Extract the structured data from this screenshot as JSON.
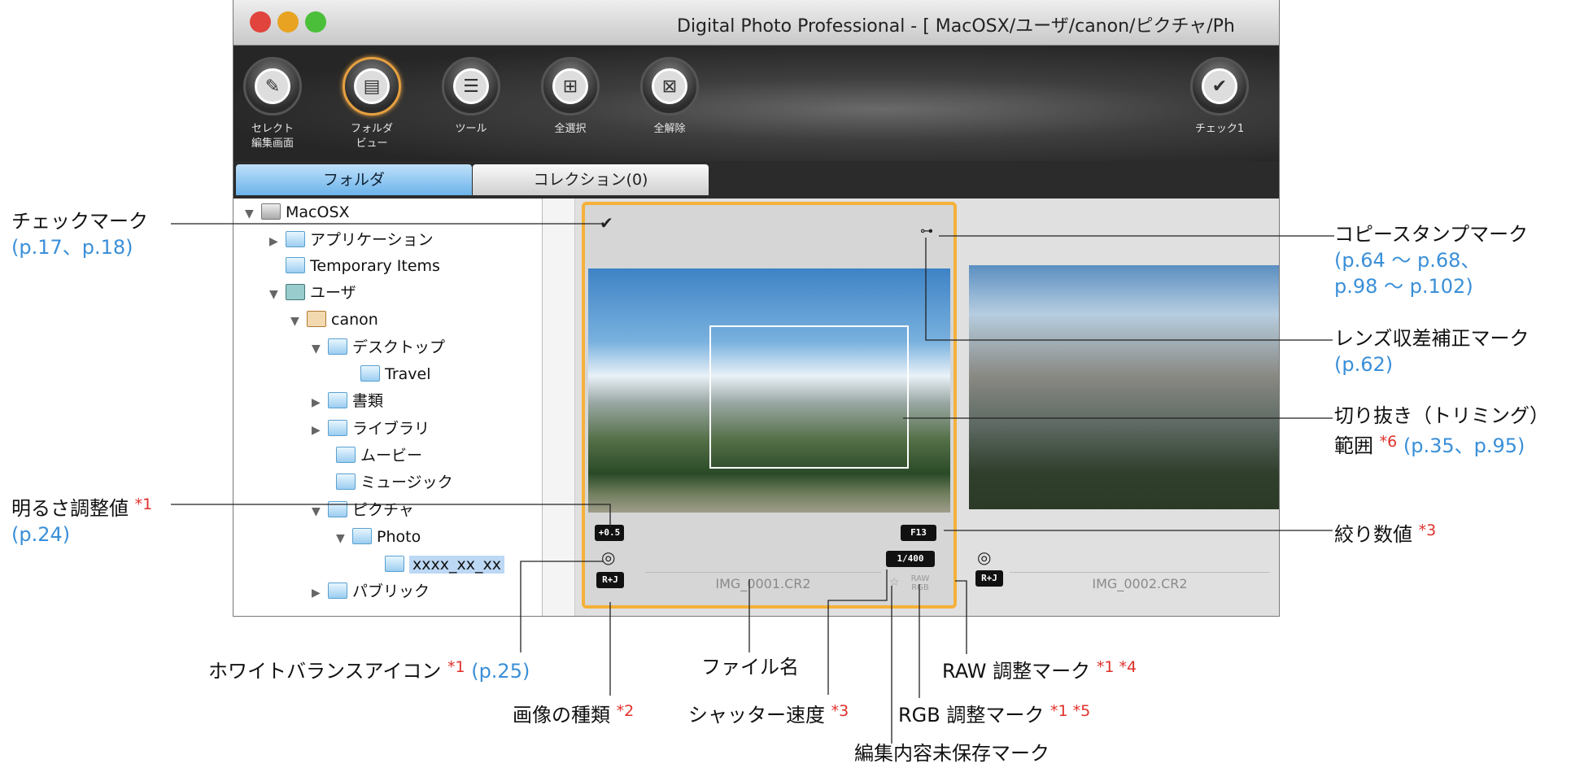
{
  "window": {
    "title": "Digital Photo Professional - [ MacOSX/ユーザ/canon/ピクチャ/Ph",
    "traffic_lights": [
      "#e0443c",
      "#e8a323",
      "#4bbf3a"
    ]
  },
  "toolbar": {
    "buttons": [
      {
        "label": "セレクト\n編集画面",
        "icon": "edit-select-icon"
      },
      {
        "label": "フォルダ\nビュー",
        "icon": "folder-view-icon"
      },
      {
        "label": "ツール",
        "icon": "tool-palette-icon"
      },
      {
        "label": "全選択",
        "icon": "select-all-icon"
      },
      {
        "label": "全解除",
        "icon": "deselect-all-icon"
      },
      {
        "label": "チェック1",
        "icon": "check-mark-icon"
      }
    ]
  },
  "tabs": {
    "folder": "フォルダ",
    "collection": "コレクション(0)"
  },
  "tree": {
    "items": [
      {
        "label": "MacOSX",
        "expanded": true
      },
      {
        "label": "アプリケーション",
        "expanded": false
      },
      {
        "label": "Temporary Items"
      },
      {
        "label": "ユーザ",
        "expanded": true
      },
      {
        "label": "canon",
        "expanded": true
      },
      {
        "label": "デスクトップ",
        "expanded": true
      },
      {
        "label": "Travel"
      },
      {
        "label": "書類",
        "expanded": false
      },
      {
        "label": "ライブラリ",
        "expanded": false
      },
      {
        "label": "ムービー"
      },
      {
        "label": "ミュージック"
      },
      {
        "label": "ピクチャ",
        "expanded": true
      },
      {
        "label": "Photo",
        "expanded": true
      },
      {
        "label": "xxxx_xx_xx",
        "selected": true
      },
      {
        "label": "パブリック",
        "expanded": false
      }
    ]
  },
  "thumbnails": [
    {
      "filename": "IMG_0001.CR2",
      "brightness": "+0.5",
      "aperture": "F13",
      "shutter": "1/400",
      "image_type": "R+J",
      "raw_label": "RAW",
      "rgb_label": "RGB",
      "unsaved_mark": "☆",
      "selected": true
    },
    {
      "filename": "IMG_0002.CR2",
      "image_type": "R+J"
    }
  ],
  "callouts": {
    "check_mark": {
      "text": "チェックマーク",
      "ref": "(p.17、p.18)"
    },
    "brightness": {
      "text": "明るさ調整値",
      "star": "*1",
      "ref": "(p.24)"
    },
    "copy_stamp": {
      "text": "コピースタンプマーク",
      "ref1": "(p.64 ～ p.68、",
      "ref2": "p.98 ～ p.102)"
    },
    "lens": {
      "text": "レンズ収差補正マーク",
      "ref": "(p.62)"
    },
    "crop": {
      "text1": "切り抜き（トリミング）",
      "text2": "範囲",
      "star": "*6",
      "ref": "(p.35、p.95)"
    },
    "aperture": {
      "text": "絞り数値",
      "star": "*3"
    },
    "wb": {
      "text": "ホワイトバランスアイコン",
      "star": "*1",
      "ref": "(p.25)"
    },
    "type": {
      "text": "画像の種類",
      "star": "*2"
    },
    "filename": {
      "text": "ファイル名"
    },
    "shutter": {
      "text": "シャッター速度",
      "star": "*3"
    },
    "raw": {
      "text": "RAW 調整マーク",
      "star": "*1 *4"
    },
    "rgb": {
      "text": "RGB 調整マーク",
      "star": "*1 *5"
    },
    "unsaved": {
      "text": "編集内容未保存マーク"
    }
  }
}
